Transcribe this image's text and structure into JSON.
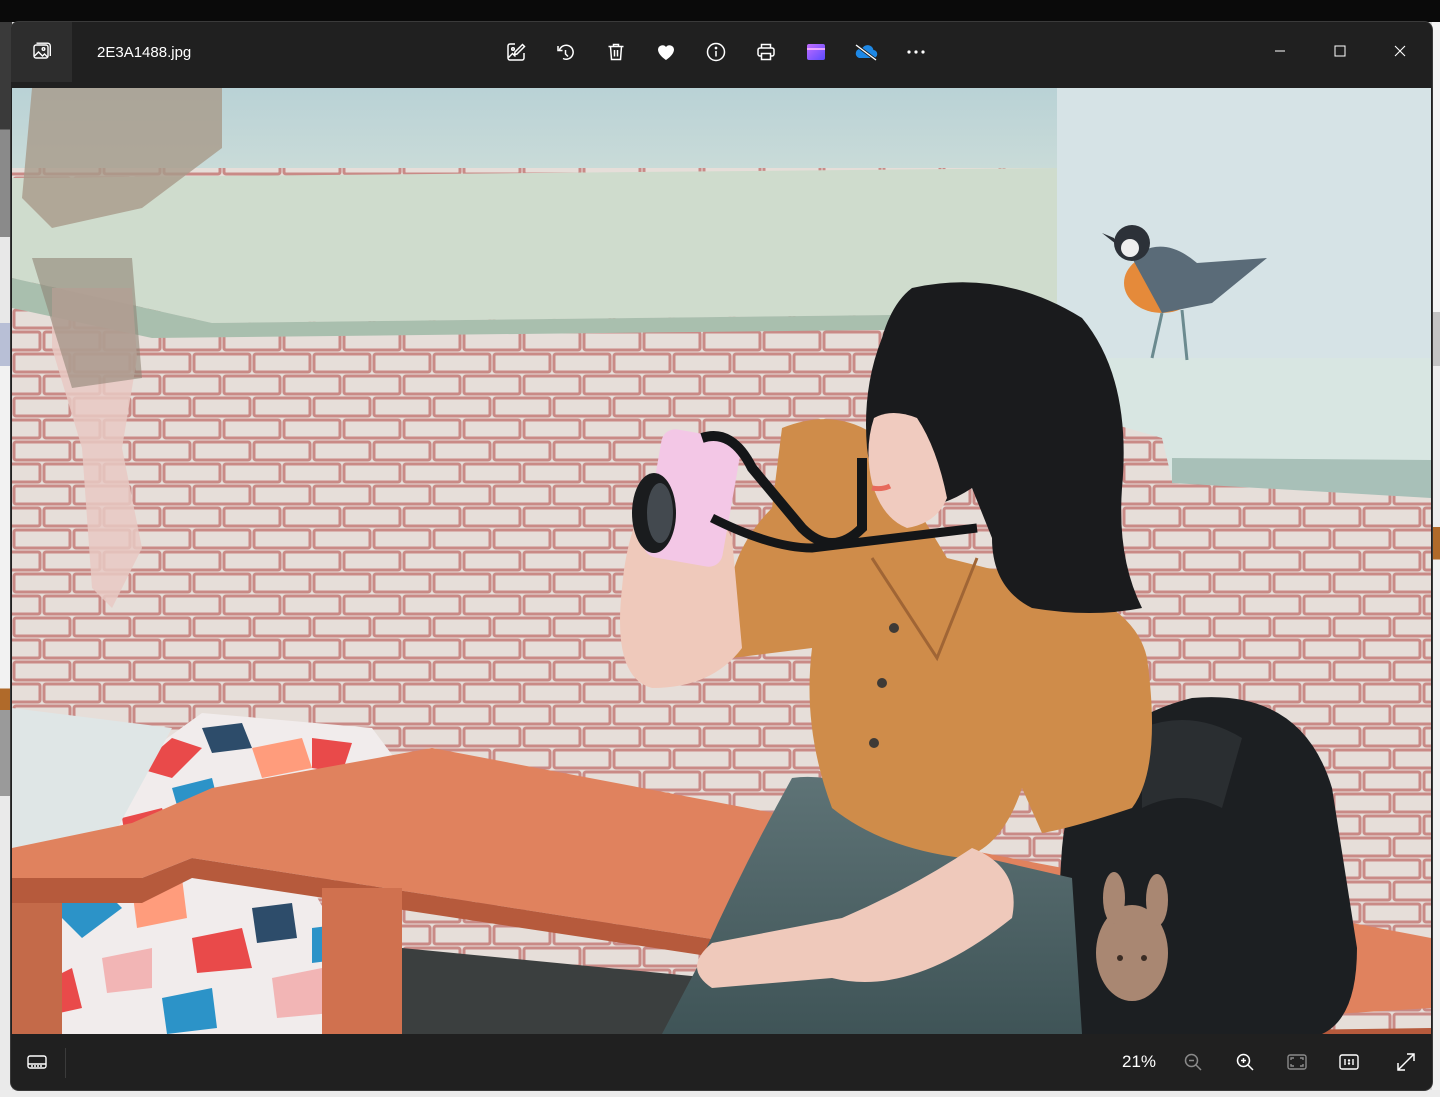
{
  "window": {
    "filename": "2E3A1488.jpg"
  },
  "toolbar": {
    "icons": [
      "edit-image-icon",
      "rotate-icon",
      "delete-icon",
      "favorite-heart-icon",
      "file-info-icon",
      "print-icon",
      "clipchamp-icon",
      "onedrive-icon",
      "more-options-icon"
    ]
  },
  "window_controls": [
    "minimize-icon",
    "maximize-icon",
    "close-icon"
  ],
  "bottom_bar": {
    "zoom_level": "21%",
    "icons": [
      "filmstrip-icon",
      "zoom-out-icon",
      "zoom-in-icon",
      "fit-to-window-icon",
      "actual-size-icon",
      "fullscreen-icon"
    ]
  },
  "colors": {
    "chrome": "#202020",
    "accent_heart": "#ffffff"
  }
}
